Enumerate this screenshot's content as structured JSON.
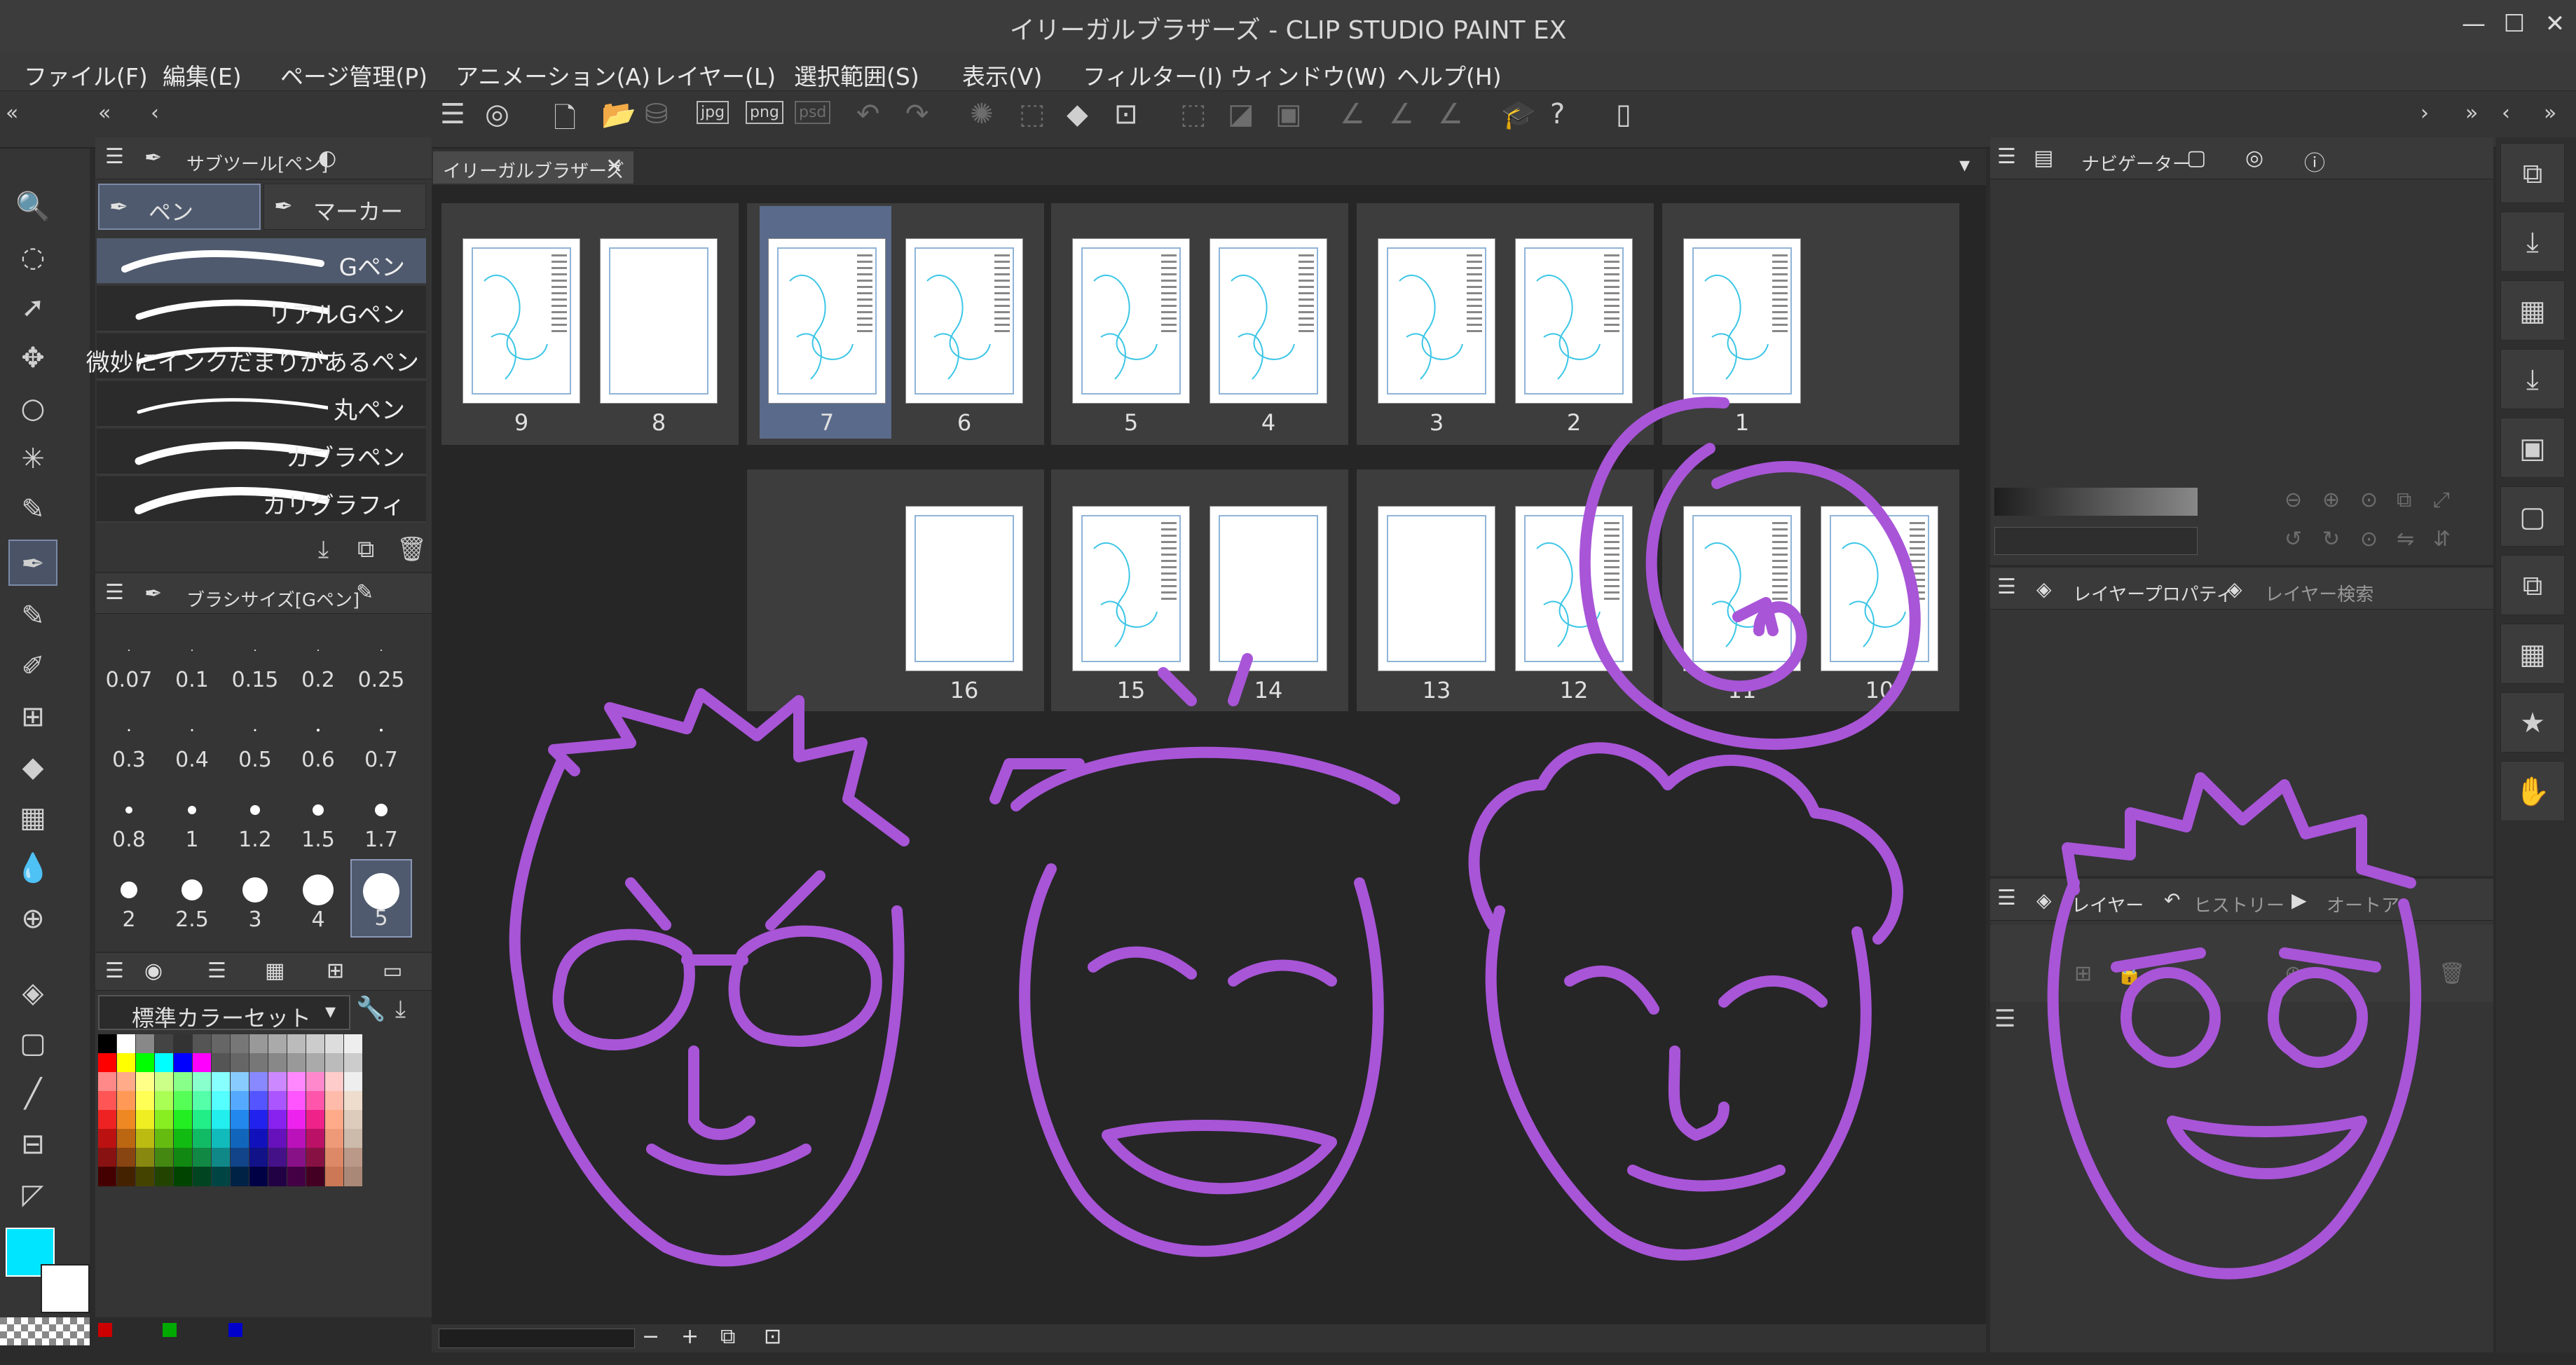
{
  "window": {
    "title": "イリーガルブラザーズ - CLIP STUDIO PAINT EX",
    "min_icon": "minimize-icon",
    "max_icon": "maximize-icon",
    "close_icon": "close-icon"
  },
  "menu": [
    "ファイル(F)",
    "編集(E)",
    "ページ管理(P)",
    "アニメーション(A)",
    "レイヤー(L)",
    "選択範囲(S)",
    "表示(V)",
    "フィルター(I)",
    "ウィンドウ(W)",
    "ヘルプ(H)"
  ],
  "subtool": {
    "title": "サブツール[ペン]",
    "tab_pen": "ペン",
    "tab_marker": "マーカー",
    "brushes": [
      "Gペン",
      "リアルGペン",
      "微妙にインクだまりがあるペン",
      "丸ペン",
      "カブラペン",
      "カリグラフィ"
    ]
  },
  "brush_size": {
    "title": "ブラシサイズ[Gペン]",
    "values": [
      "0.07",
      "0.1",
      "0.15",
      "0.2",
      "0.25",
      "0.3",
      "0.4",
      "0.5",
      "0.6",
      "0.7",
      "0.8",
      "1",
      "1.2",
      "1.5",
      "1.7",
      "2",
      "2.5",
      "3",
      "4",
      "5"
    ],
    "selected": "5"
  },
  "color_set": {
    "name": "標準カラーセット"
  },
  "colors": {
    "main": "#00e5ff",
    "sub": "#ffffff",
    "accent": "#a855d8",
    "selected": "#4f5a6e"
  },
  "document": {
    "tab": "イリーガルブラザーズ",
    "pages_row1": [
      "9",
      "8",
      "7",
      "6",
      "5",
      "4",
      "3",
      "2",
      "1"
    ],
    "pages_row2": [
      "16",
      "15",
      "14",
      "13",
      "12",
      "11",
      "10"
    ]
  },
  "right": {
    "navigator": "ナビゲーター",
    "layer_property": "レイヤープロパティ",
    "layer_search": "レイヤー検索",
    "layer": "レイヤー",
    "history": "ヒストリー",
    "auto_action": "オートア"
  }
}
